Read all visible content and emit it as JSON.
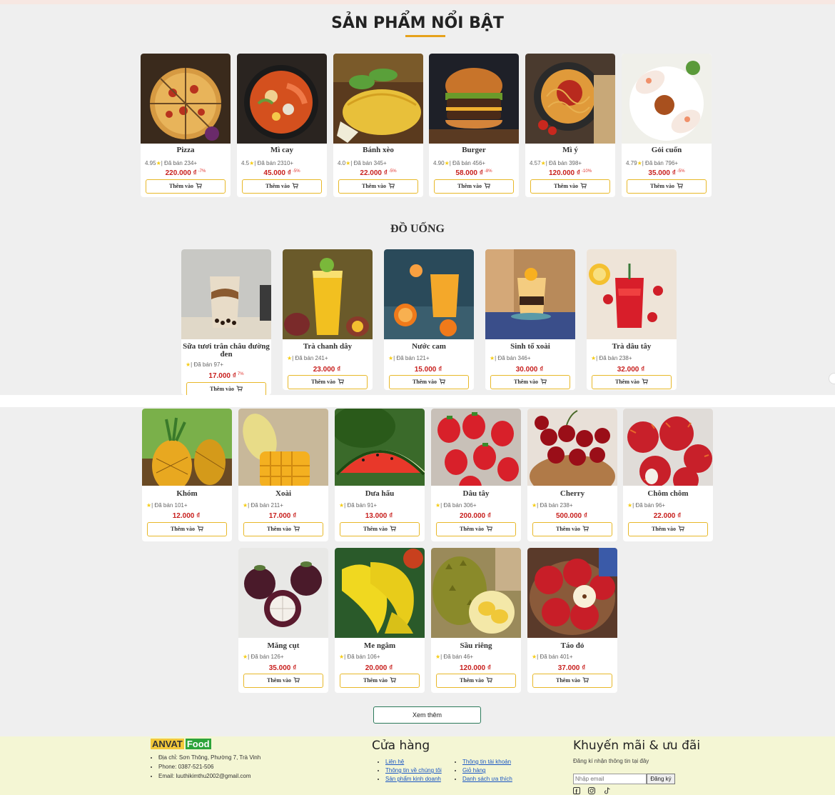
{
  "featured": {
    "title": "SẢN PHẨM NỔI BẬT",
    "items": [
      {
        "name": "Pizza",
        "meta": "4.95|★| Đã bán 234+",
        "rating": "4.95",
        "sold": "| Đã bán 234+",
        "price": "220.000 ₫",
        "discount": "-7%"
      },
      {
        "name": "Mì cay",
        "rating": "4.5",
        "sold": "| Đã bán 2310+",
        "price": "45.000 ₫",
        "discount": "-5%"
      },
      {
        "name": "Bánh xèo",
        "rating": "4.0",
        "sold": "| Đã bán 345+",
        "price": "22.000 ₫",
        "discount": "-5%"
      },
      {
        "name": "Burger",
        "rating": "4.90",
        "sold": "| Đã bán 456+",
        "price": "58.000 ₫",
        "discount": "-8%"
      },
      {
        "name": "Mì ý",
        "rating": "4.57",
        "sold": "| Đã bán 398+",
        "price": "120.000 ₫",
        "discount": "-10%"
      },
      {
        "name": "Gỏi cuốn",
        "rating": "4.79",
        "sold": "| Đã bán 796+",
        "price": "35.000 ₫",
        "discount": "-5%"
      }
    ]
  },
  "drinks": {
    "title": "ĐỒ UỐNG",
    "items": [
      {
        "name": "Sữa tươi trân châu đường đen",
        "sold": "| Đã bán 97+",
        "price": "17.000 ₫",
        "discount": "7%"
      },
      {
        "name": "Trà chanh dây",
        "sold": "| Đã bán 241+",
        "price": "23.000 ₫"
      },
      {
        "name": "Nước cam",
        "sold": "| Đã bán 121+",
        "price": "15.000 ₫"
      },
      {
        "name": "Sinh tố xoài",
        "sold": "| Đã bán 346+",
        "price": "30.000 ₫"
      },
      {
        "name": "Trà dâu tây",
        "sold": "| Đã bán 238+",
        "price": "32.000 ₫"
      }
    ]
  },
  "fruits": {
    "items": [
      {
        "name": "Khóm",
        "sold": "| Đã bán 101+",
        "price": "12.000 ₫"
      },
      {
        "name": "Xoài",
        "sold": "| Đã bán 211+",
        "price": "17.000 ₫"
      },
      {
        "name": "Dưa hấu",
        "sold": "| Đã bán 91+",
        "price": "13.000 ₫"
      },
      {
        "name": "Dâu tây",
        "sold": "| Đã bán 306+",
        "price": "200.000 ₫"
      },
      {
        "name": "Cherry",
        "sold": "| Đã bán 238+",
        "price": "500.000 ₫"
      },
      {
        "name": "Chôm chôm",
        "sold": "| Đã bán 96+",
        "price": "22.000 ₫"
      },
      {
        "name": "Măng cụt",
        "sold": "| Đã bán 126+",
        "price": "35.000 ₫"
      },
      {
        "name": "Me ngâm",
        "sold": "| Đã bán 106+",
        "price": "20.000 ₫"
      },
      {
        "name": "Sầu riêng",
        "sold": "| Đã bán 46+",
        "price": "120.000 ₫"
      },
      {
        "name": "Táo đỏ",
        "sold": "| Đã bán 401+",
        "price": "37.000 ₫"
      }
    ]
  },
  "common": {
    "add_label": "Thêm vào",
    "cart_icon": "cart-icon",
    "star_icon": "star-icon",
    "star_glyph": "★",
    "more_label": "Xem thêm"
  },
  "footer": {
    "brand_part1": "ANVAT",
    "brand_part2": "Food",
    "address": "Địa chỉ: Sơn Thông, Phường 7, Trà Vinh",
    "phone": "Phone: 0387-521-506",
    "email": "Email: luuthikimthu2002@gmail.com",
    "store_title": "Cửa hàng",
    "links_col1": [
      "Liên hệ",
      "Thông tin về chúng tôi",
      "Sản phẩm kinh doanh"
    ],
    "links_col2": [
      "Thông tin tài khoản",
      "Giỏ hàng",
      "Danh sách ưa thích"
    ],
    "promo_title": "Khuyến mãi & ưu đãi",
    "promo_subtitle": "Đăng kí nhận thông tin tại đây",
    "email_placeholder": "Nhập email",
    "signup_label": "Đăng ký",
    "social_icons": [
      "facebook-icon",
      "instagram-icon",
      "tiktok-icon"
    ]
  },
  "colors": {
    "accent": "#e6a21c",
    "price": "#c8201e",
    "footer_bg": "#f4f6d4",
    "brand_green": "#2da43a",
    "brand_yellow": "#f2c83a"
  }
}
